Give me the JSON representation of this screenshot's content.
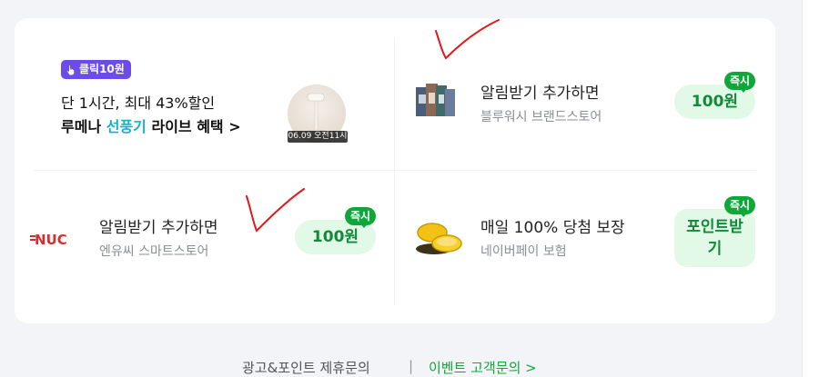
{
  "promo": {
    "badge": "클릭10원",
    "line1": "단 1시간, 최대 43%할인",
    "line2_part1": "루메나 ",
    "line2_highlight": "선풍기",
    "line2_part2": " 라이브 혜택 >",
    "thumb_time": "06.09 오전11시"
  },
  "items": [
    {
      "title": "알림받기 추가하면",
      "subtitle": "블루워시 브랜드스토어",
      "reward": "100원",
      "instant": "즉시"
    },
    {
      "title": "알림받기 추가하면",
      "subtitle": "엔유씨 스마트스토어",
      "reward": "100원",
      "instant": "즉시",
      "logo_text": "NUC"
    },
    {
      "title": "매일 100% 당첨 보장",
      "subtitle": "네이버페이 보험",
      "reward": "포인트받기",
      "instant": "즉시"
    }
  ],
  "footer": {
    "ad_link": "광고&포인트 제휴문의",
    "separator": "|",
    "event_link": "이벤트 고객문의 >"
  },
  "colors": {
    "accent_green": "#0fa73a",
    "pill_bg": "#e1f9e6",
    "badge_purple": "#6b4ce6",
    "highlight_teal": "#17b1c4"
  }
}
